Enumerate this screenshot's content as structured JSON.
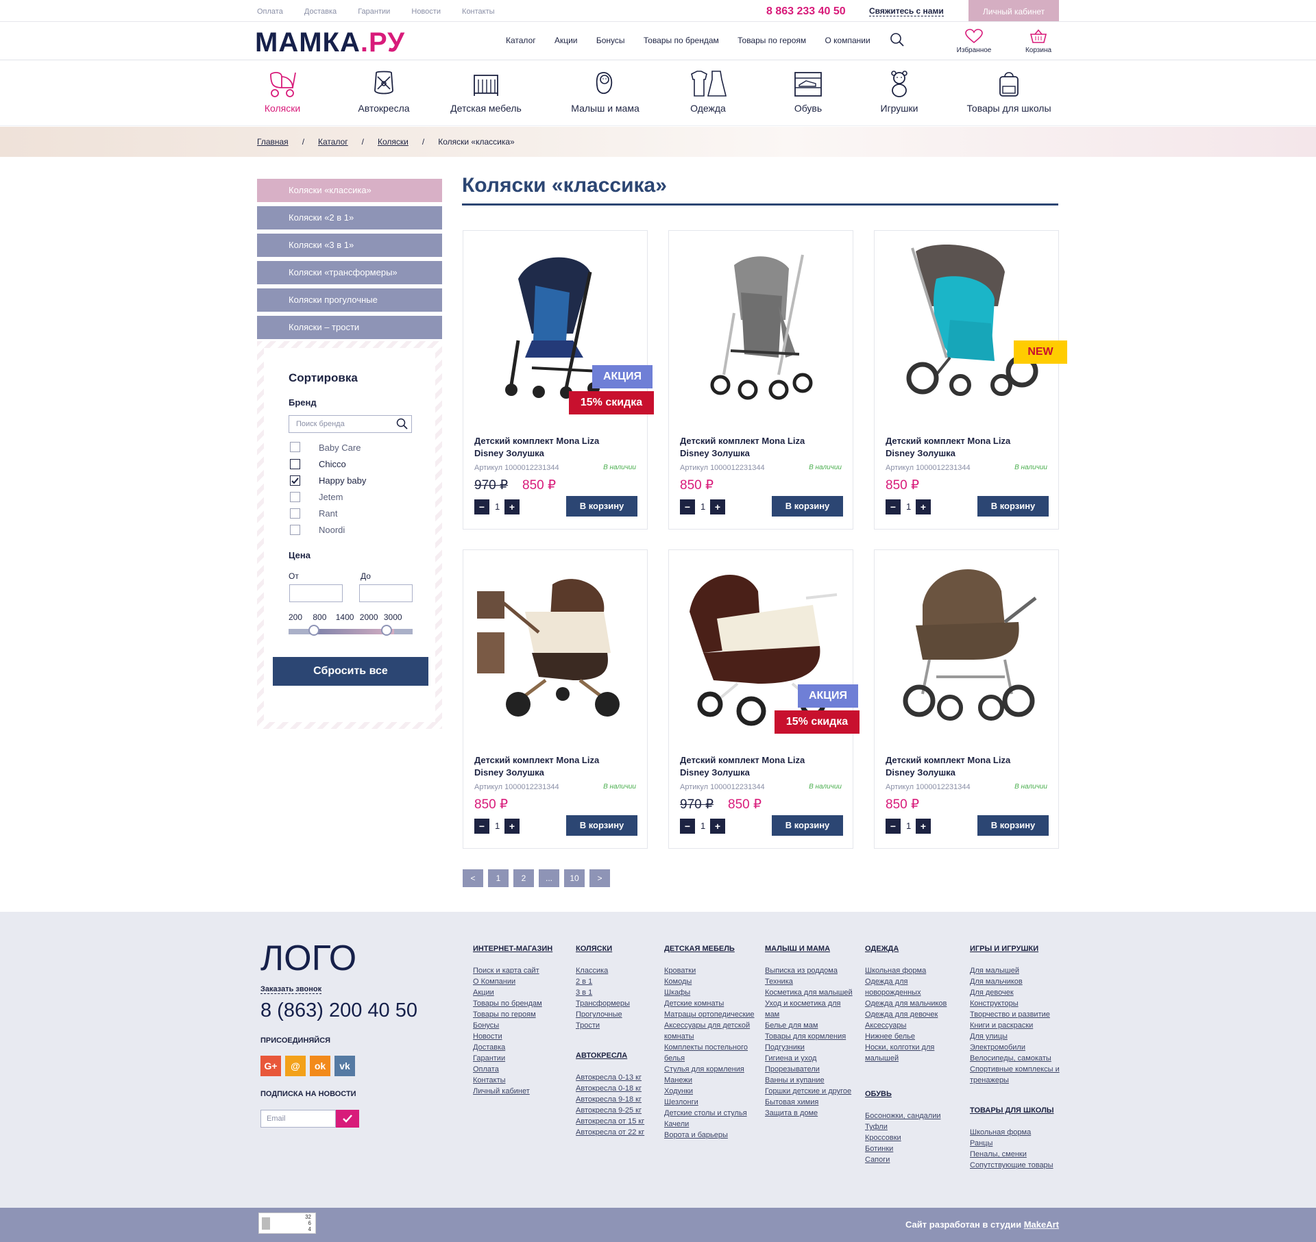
{
  "topbar": {
    "links": [
      "Оплата",
      "Доставка",
      "Гарантии",
      "Новости",
      "Контакты"
    ],
    "phone": "8 863 233 40 50",
    "contact": "Свяжитесь с нами",
    "cabinet": "Личный кабинет"
  },
  "header": {
    "logo_main": "МАМКА",
    "logo_ru": ".РУ",
    "nav": [
      "Каталог",
      "Акции",
      "Бонусы",
      "Товары по брендам",
      "Товары по героям",
      "О компании"
    ],
    "favorites": "Избранное",
    "cart": "Корзина"
  },
  "categories": [
    "Коляски",
    "Автокресла",
    "Детская мебель",
    "Малыш и мама",
    "Одежда",
    "Обувь",
    "Игрушки",
    "Товары для школы"
  ],
  "breadcrumbs": [
    "Главная",
    "Каталог",
    "Коляски",
    "Коляски «классика»"
  ],
  "sidebar": {
    "items": [
      "Коляски «классика»",
      "Коляски «2 в 1»",
      "Коляски «3 в 1»",
      "Коляски «трансформеры»",
      "Коляски прогулочные",
      "Коляски – трости"
    ]
  },
  "filter": {
    "title": "Сортировка",
    "brand_label": "Бренд",
    "search_placeholder": "Поиск бренда",
    "brands": [
      {
        "name": "Baby Care",
        "checked": false
      },
      {
        "name": "Chicco",
        "checked": false
      },
      {
        "name": "Happy baby",
        "checked": true
      },
      {
        "name": "Jetem",
        "checked": false
      },
      {
        "name": "Rant",
        "checked": false
      },
      {
        "name": "Noordi",
        "checked": false
      }
    ],
    "price_label": "Цена",
    "from_label": "От",
    "to_label": "До",
    "ticks": [
      "200",
      "800",
      "1400",
      "2000",
      "3000"
    ],
    "reset": "Сбросить все"
  },
  "page_title": "Коляски «классика»",
  "products": [
    {
      "name": "Детский комплект Mona Liza Disney Золушка",
      "article": "Артикул 1000012231344",
      "stock": "В наличии",
      "old_price": "970 ₽",
      "price": "850 ₽",
      "qty": "1",
      "buy": "В корзину",
      "badge_sale": "АКЦИЯ",
      "badge_discount": "15% скидка",
      "badge_new": ""
    },
    {
      "name": "Детский комплект Mona Liza Disney Золушка",
      "article": "Артикул 1000012231344",
      "stock": "В наличии",
      "old_price": "",
      "price": "850 ₽",
      "qty": "1",
      "buy": "В корзину",
      "badge_sale": "",
      "badge_discount": "",
      "badge_new": ""
    },
    {
      "name": "Детский комплект Mona Liza Disney Золушка",
      "article": "Артикул 1000012231344",
      "stock": "В наличии",
      "old_price": "",
      "price": "850 ₽",
      "qty": "1",
      "buy": "В корзину",
      "badge_sale": "",
      "badge_discount": "",
      "badge_new": "NEW"
    },
    {
      "name": "Детский комплект Mona Liza Disney Золушка",
      "article": "Артикул 1000012231344",
      "stock": "В наличии",
      "old_price": "",
      "price": "850 ₽",
      "qty": "1",
      "buy": "В корзину",
      "badge_sale": "",
      "badge_discount": "",
      "badge_new": ""
    },
    {
      "name": "Детский комплект Mona Liza Disney Золушка",
      "article": "Артикул 1000012231344",
      "stock": "В наличии",
      "old_price": "970 ₽",
      "price": "850 ₽",
      "qty": "1",
      "buy": "В корзину",
      "badge_sale": "АКЦИЯ",
      "badge_discount": "15% скидка",
      "badge_new": ""
    },
    {
      "name": "Детский комплект Mona Liza Disney Золушка",
      "article": "Артикул 1000012231344",
      "stock": "В наличии",
      "old_price": "",
      "price": "850 ₽",
      "qty": "1",
      "buy": "В корзину",
      "badge_sale": "",
      "badge_discount": "",
      "badge_new": ""
    }
  ],
  "pagination": [
    "<",
    "1",
    "2",
    "...",
    "10",
    ">"
  ],
  "footer": {
    "logo": "ЛОГО",
    "call": "Заказать звонок",
    "phone": "8 (863) 200 40 50",
    "join": "ПРИСОЕДИНЯЙСЯ",
    "social": [
      "G+",
      "@",
      "ok",
      "vk"
    ],
    "subscribe": "ПОДПИСКА НА НОВОСТИ",
    "email_placeholder": "Email",
    "columns": [
      {
        "title": "ИНТЕРНЕТ-МАГАЗИН",
        "items": [
          "Поиск и карта сайт",
          "О Компании",
          "Акции",
          "Товары по брендам",
          "Товары по героям",
          "Бонусы",
          "Новости",
          "Доставка",
          "Гарантии",
          "Оплата",
          "Контакты",
          "Личный кабинет"
        ]
      },
      {
        "title": "КОЛЯСКИ",
        "items": [
          "Классика",
          "2 в 1",
          "3 в 1",
          "Трансформеры",
          "Прогулочные",
          "Трости"
        ]
      },
      {
        "title": "АВТОКРЕСЛА",
        "items": [
          "Автокресла 0-13 кг",
          "Автокресла 0-18 кг",
          "Автокресла 9-18 кг",
          "Автокресла 9-25 кг",
          "Автокресла от 15 кг",
          "Автокресла от 22 кг"
        ]
      },
      {
        "title": "ДЕТСКАЯ МЕБЕЛЬ",
        "items": [
          "Кроватки",
          "Комоды",
          "Шкафы",
          "Детские комнаты",
          "Матрацы ортопедические",
          "Аксессуары для детской комнаты",
          "Комплекты постельного белья",
          "Стулья для кормления",
          "Манежи",
          "Ходунки",
          "Шезлонги",
          "Детские столы и стулья",
          "Качели",
          "Ворота и барьеры"
        ]
      },
      {
        "title": "МАЛЫШ И МАМА",
        "items": [
          "Выписка из роддома",
          "Техника",
          "Косметика для малышей",
          "Уход и косметика для мам",
          "Белье для мам",
          "Товары для кормления",
          "Подгузники",
          "Гигиена и уход",
          "Прорезыватели",
          "Ванны и купание",
          "Горшки детские и другое",
          "Бытовая химия",
          "Защита в доме"
        ]
      },
      {
        "title": "ОДЕЖДА",
        "items": [
          "Школьная форма",
          "Одежда для новорожденных",
          "Одежда для мальчиков",
          "Одежда для девочек",
          "Аксессуары",
          "Нижнее белье",
          "Носки, колготки для малышей"
        ]
      },
      {
        "title": "ОБУВЬ",
        "items": [
          "Босоножки, сандалии",
          "Туфли",
          "Кроссовки",
          "Ботинки",
          "Сапоги"
        ]
      },
      {
        "title": "ИГРЫ И ИГРУШКИ",
        "items": [
          "Для малышей",
          "Для мальчиков",
          "Для девочек",
          "Конструкторы",
          "Творчество и развитие",
          "Книги и раскраски",
          "Для улицы",
          "Электромобили",
          "Велосипеды, самокаты",
          "Спортивные комплексы и тренажеры"
        ]
      },
      {
        "title": "ТОВАРЫ ДЛЯ ШКОЛЫ",
        "items": [
          "Школьная форма",
          "Ранцы",
          "Пеналы, сменки",
          "Сопутствующие товары"
        ]
      }
    ],
    "counter": [
      "32",
      "6",
      "4"
    ],
    "made_by_prefix": "Сайт разработан в студии ",
    "made_by_link": "MakeArt"
  },
  "colors": {
    "accent": "#d81b7a",
    "navy": "#2c4673",
    "sidebar": "#8e94b6",
    "sidebar_active": "#d8b0c6"
  }
}
